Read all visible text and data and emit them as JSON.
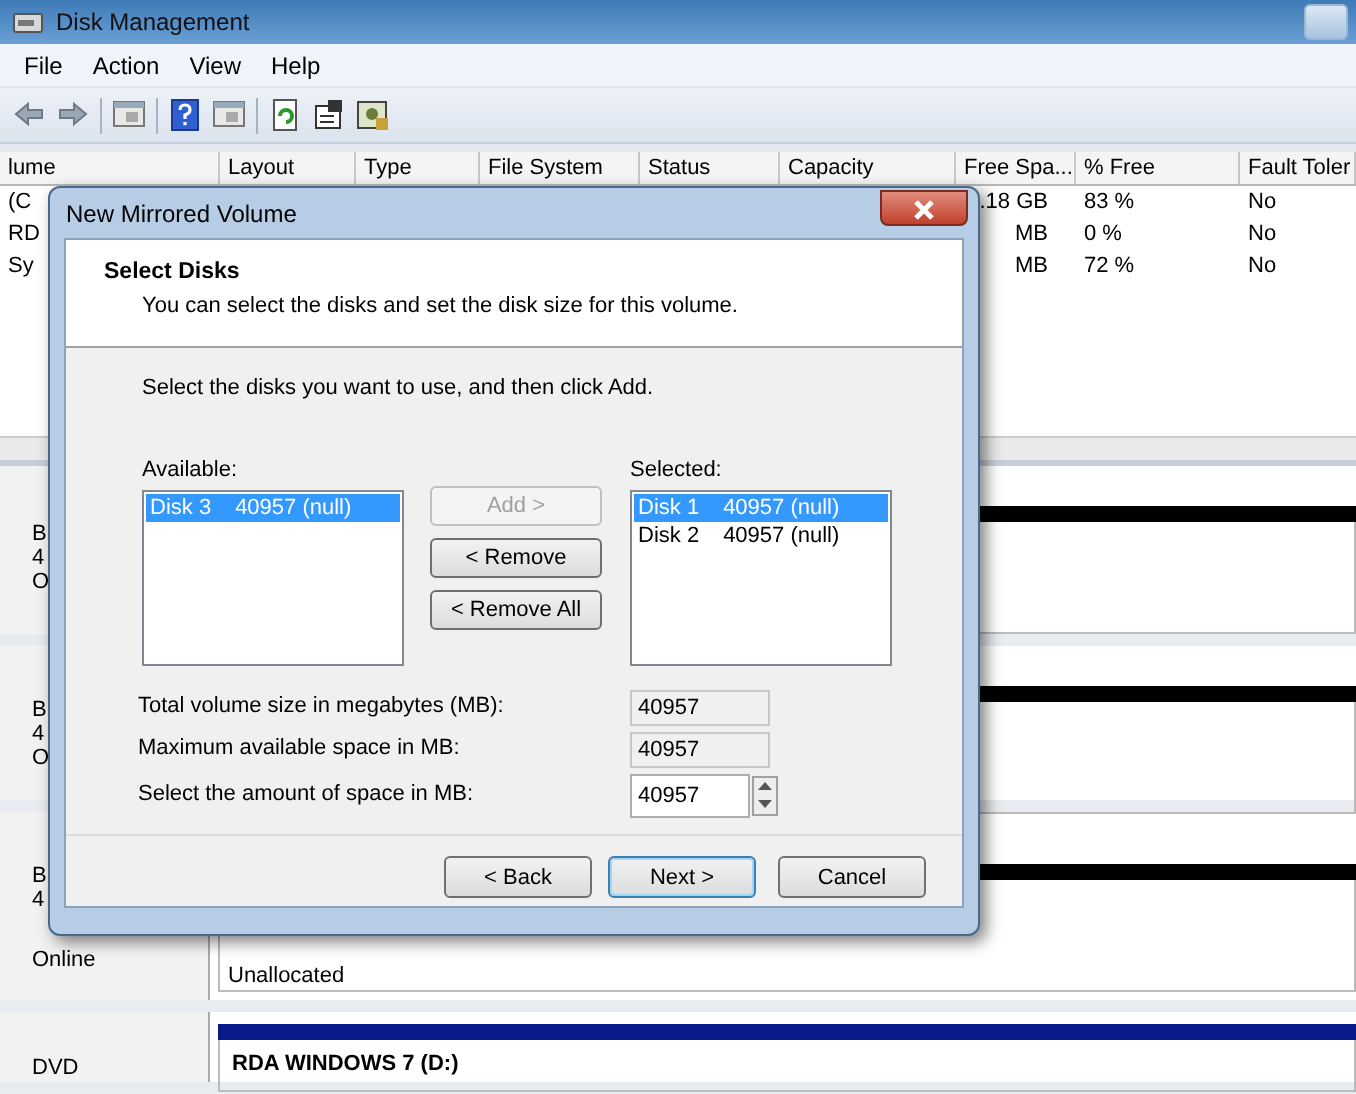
{
  "window": {
    "title": "Disk Management"
  },
  "menu": [
    "File",
    "Action",
    "View",
    "Help"
  ],
  "toolbar": [
    {
      "kind": "back"
    },
    {
      "kind": "forward"
    },
    {
      "kind": "separator"
    },
    {
      "kind": "pane"
    },
    {
      "kind": "separator"
    },
    {
      "kind": "help"
    },
    {
      "kind": "pane"
    },
    {
      "kind": "separator"
    },
    {
      "kind": "refresh"
    },
    {
      "kind": "properties"
    },
    {
      "kind": "disk"
    }
  ],
  "volume_table": {
    "columns": [
      "lume",
      "Layout",
      "Type",
      "File System",
      "Status",
      "Capacity",
      "Free Spa...",
      "% Free",
      "Fault Toler"
    ],
    "rows": [
      {
        "column_1": "(C",
        "free_space": ".18 GB",
        "percent_free": "83 %",
        "fault_tolerance": "No"
      },
      {
        "column_1": "RD",
        "free_space": "MB",
        "percent_free": "0 %",
        "fault_tolerance": "No"
      },
      {
        "column_1": "Sy",
        "free_space": "MB",
        "percent_free": "72 %",
        "fault_tolerance": "No"
      }
    ]
  },
  "disks": [
    {
      "kind": "disk",
      "lines": [
        "B",
        "4",
        "O"
      ]
    },
    {
      "kind": "disk",
      "lines": [
        "B",
        "4",
        "O"
      ]
    },
    {
      "kind": "disk",
      "lines": [
        "B",
        "4",
        "Online"
      ],
      "partition": "Unallocated"
    },
    {
      "kind": "dvd",
      "lines": [
        "DVD"
      ],
      "partition": "RDA WINDOWS 7 (D:)"
    }
  ],
  "dialog": {
    "title": "New Mirrored Volume",
    "heading": "Select Disks",
    "subtitle": "You can select the disks and set the disk size for this volume.",
    "instruction": "Select the disks you want to use, and then click Add.",
    "available": {
      "label": "Available:",
      "items": [
        {
          "disk": "Disk 3",
          "size": "40957 (null)",
          "selected": true
        }
      ]
    },
    "move_buttons": [
      {
        "label": "Add >",
        "disabled": true
      },
      {
        "label": "< Remove",
        "disabled": false
      },
      {
        "label": "< Remove All",
        "disabled": false
      }
    ],
    "selected": {
      "label": "Selected:",
      "items": [
        {
          "disk": "Disk 1",
          "size": "40957 (null)",
          "selected": true
        },
        {
          "disk": "Disk 2",
          "size": "40957 (null)",
          "selected": false
        }
      ]
    },
    "fields": [
      {
        "kind": "readonly",
        "label": "Total volume size in megabytes (MB):",
        "value": "40957"
      },
      {
        "kind": "readonly",
        "label": "Maximum available space in MB:",
        "value": "40957"
      },
      {
        "kind": "spinner",
        "label": "Select the amount of space in MB:",
        "value": "40957"
      }
    ],
    "buttons": [
      {
        "label": "< Back",
        "default": false
      },
      {
        "label": "Next >",
        "default": true
      },
      {
        "label": "Cancel",
        "default": false
      }
    ]
  }
}
